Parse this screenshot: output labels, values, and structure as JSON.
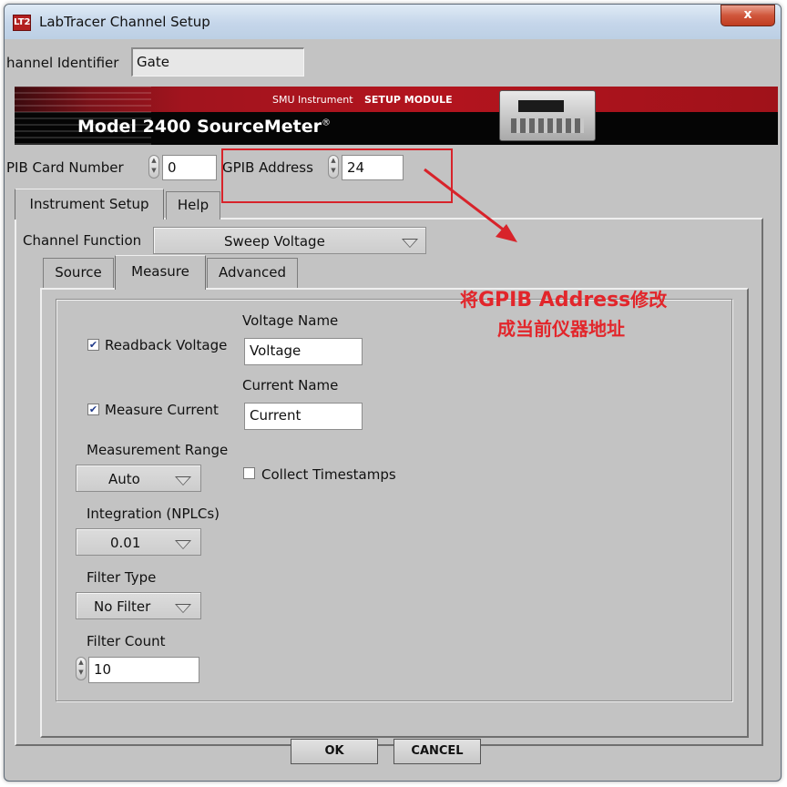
{
  "window": {
    "title": "LabTracer Channel Setup",
    "app_icon_text": "LT2",
    "close_label": "x"
  },
  "channel": {
    "label": "hannel Identifier",
    "value": "Gate"
  },
  "banner": {
    "smu": "SMU Instrument",
    "setup": "SETUP MODULE",
    "model": "Model 2400 SourceMeter",
    "trademark": "®"
  },
  "gpib": {
    "card_label": "PIB Card Number",
    "card_value": "0",
    "address_label": "GPIB Address",
    "address_value": "24"
  },
  "tabs": {
    "instrument_setup": "Instrument Setup",
    "help": "Help"
  },
  "channel_function": {
    "label": "Channel Function",
    "value": "Sweep Voltage"
  },
  "subtabs": {
    "source": "Source",
    "measure": "Measure",
    "advanced": "Advanced"
  },
  "measure": {
    "voltage_name_label": "Voltage Name",
    "voltage_name_value": "Voltage",
    "readback_voltage_label": "Readback Voltage",
    "readback_voltage_checked": true,
    "current_name_label": "Current Name",
    "current_name_value": "Current",
    "measure_current_label": "Measure Current",
    "measure_current_checked": true,
    "range_label": "Measurement Range",
    "range_value": "Auto",
    "timestamps_label": "Collect Timestamps",
    "timestamps_checked": false,
    "integration_label": "Integration (NPLCs)",
    "integration_value": "0.01",
    "filter_type_label": "Filter Type",
    "filter_type_value": "No Filter",
    "filter_count_label": "Filter Count",
    "filter_count_value": "10"
  },
  "buttons": {
    "ok": "OK",
    "cancel": "CANCEL"
  },
  "annotation": {
    "line1_prefix": "将",
    "line1_bold": "GPIB Address",
    "line1_suffix": "修改",
    "line2": "成当前仪器地址",
    "color": "#e2262b"
  },
  "colors": {
    "dialog_bg": "#c3c3c3",
    "banner_red": "#b3141e",
    "annotation_red": "#d8232a"
  }
}
